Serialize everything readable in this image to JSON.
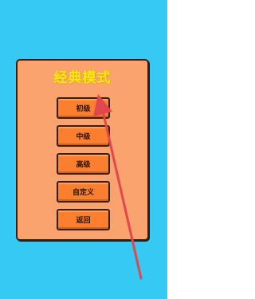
{
  "menu": {
    "title": "经典模式",
    "buttons": {
      "beginner": "初级",
      "intermediate": "中级",
      "advanced": "高级",
      "custom": "自定义",
      "back": "返回"
    }
  },
  "colors": {
    "background": "#35c9f3",
    "panel": "#fba36f",
    "title": "#ffe41c",
    "button": "#fb7f2e",
    "border": "#3b1e12",
    "annotation_arrow": "#e2474c"
  }
}
